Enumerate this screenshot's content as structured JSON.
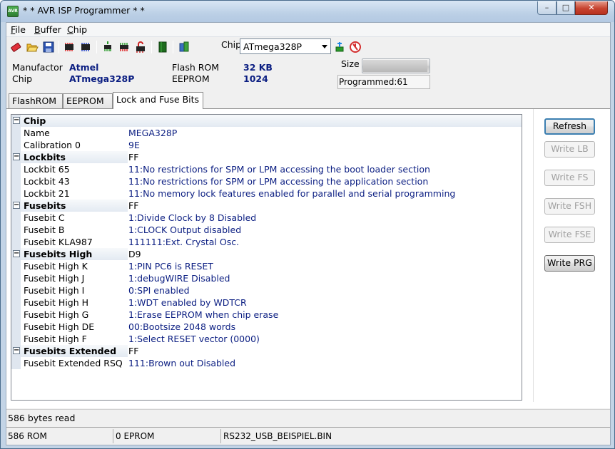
{
  "window": {
    "title": "* * AVR ISP Programmer * *",
    "icon_text": "AVR",
    "controls": {
      "minimize": "–",
      "maximize": "□",
      "close": "✕"
    }
  },
  "menu": {
    "items": [
      {
        "label": "File",
        "u": "F",
        "rest": "ile"
      },
      {
        "label": "Buffer",
        "u": "B",
        "rest": "uffer"
      },
      {
        "label": "Chip",
        "u": "C",
        "rest": "hip"
      }
    ]
  },
  "toolbar": {
    "icons": [
      "eraser-icon",
      "open-folder-icon",
      "save-icon",
      "read-chip-icon",
      "write-chip-icon",
      "read-ram-icon",
      "program-icon",
      "lock-icon",
      "book-icon",
      "run-icon"
    ],
    "chip_label": "Chip",
    "chip_selected": "ATmega328P",
    "extra_icons": [
      "usb-plug-icon",
      "stop-icon"
    ]
  },
  "info": {
    "manufacturer_label": "Manufactor",
    "manufacturer_value": "Atmel",
    "chip_label": "Chip",
    "chip_value": "ATmega328P",
    "flash_label": "Flash ROM",
    "flash_value": "32 KB",
    "eeprom_label": "EEPROM",
    "eeprom_value": "1024",
    "size_label": "Size",
    "size_fraction": 0.98,
    "programmed_text": "Programmed:61"
  },
  "tabs": [
    {
      "label": "FlashROM",
      "active": false
    },
    {
      "label": "EEPROM",
      "active": false
    },
    {
      "label": "Lock and Fuse Bits",
      "active": true
    }
  ],
  "grid": {
    "rows": [
      {
        "type": "cat",
        "name": "Chip",
        "value": ""
      },
      {
        "type": "item",
        "name": "Name",
        "value": "MEGA328P"
      },
      {
        "type": "item",
        "name": "Calibration 0",
        "value": "9E"
      },
      {
        "type": "cat",
        "name": "Lockbits",
        "value": "FF"
      },
      {
        "type": "item",
        "name": "Lockbit 65",
        "value": "11:No restrictions for SPM or LPM accessing the boot loader section"
      },
      {
        "type": "item",
        "name": "Lockbit 43",
        "value": "11:No restrictions for SPM or LPM accessing the application section"
      },
      {
        "type": "item",
        "name": "Lockbit 21",
        "value": "11:No memory lock features enabled for parallel and serial programming"
      },
      {
        "type": "cat",
        "name": "Fusebits",
        "value": "FF"
      },
      {
        "type": "item",
        "name": "Fusebit C",
        "value": "1:Divide Clock by 8 Disabled"
      },
      {
        "type": "item",
        "name": "Fusebit B",
        "value": "1:CLOCK Output disabled"
      },
      {
        "type": "item",
        "name": "Fusebit KLA987",
        "value": "111111:Ext. Crystal Osc."
      },
      {
        "type": "cat",
        "name": "Fusebits High",
        "value": "D9"
      },
      {
        "type": "item",
        "name": "Fusebit High K",
        "value": "1:PIN PC6 is RESET"
      },
      {
        "type": "item",
        "name": "Fusebit High J",
        "value": "1:debugWIRE Disabled"
      },
      {
        "type": "item",
        "name": "Fusebit High I",
        "value": "0:SPI enabled"
      },
      {
        "type": "item",
        "name": "Fusebit High H",
        "value": "1:WDT enabled by WDTCR"
      },
      {
        "type": "item",
        "name": "Fusebit High G",
        "value": "1:Erase EEPROM when chip erase"
      },
      {
        "type": "item",
        "name": "Fusebit High DE",
        "value": "00:Bootsize 2048 words"
      },
      {
        "type": "item",
        "name": "Fusebit High F",
        "value": "1:Select RESET vector (0000)"
      },
      {
        "type": "cat",
        "name": "Fusebits Extended",
        "value": "FF"
      },
      {
        "type": "item",
        "name": "Fusebit Extended RSQ",
        "value": "111:Brown out Disabled"
      }
    ]
  },
  "buttons": {
    "refresh": "Refresh",
    "write_lb": "Write LB",
    "write_fs": "Write FS",
    "write_fsh": "Write FSH",
    "write_fse": "Write FSE",
    "write_prg": "Write PRG"
  },
  "status": {
    "message": "586 bytes read",
    "rom": "586 ROM",
    "eprom": "0 EPROM",
    "file": "RS232_USB_BEISPIEL.BIN"
  }
}
